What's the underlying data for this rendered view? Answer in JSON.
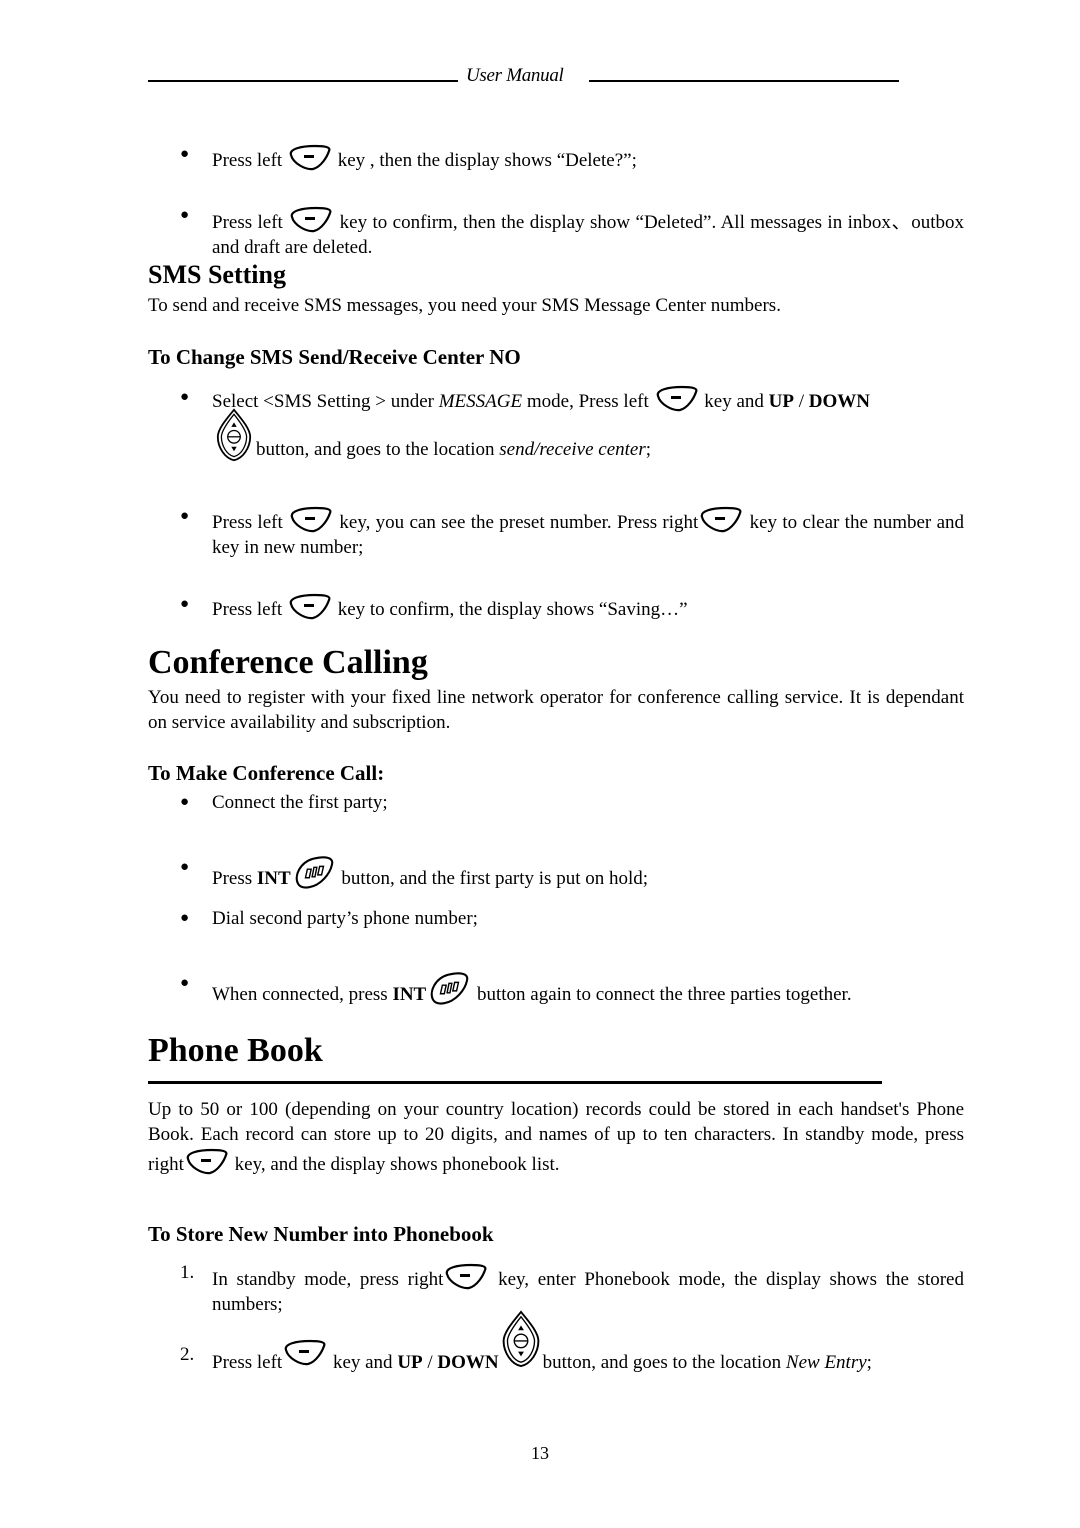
{
  "header": {
    "title": "User Manual"
  },
  "delete_steps": [
    {
      "pre": "Press left",
      "icon": "soft-key-icon",
      "post": " key , then the display shows “Delete?”;"
    },
    {
      "pre": "Press left",
      "icon": "soft-key-icon",
      "post": "key to confirm, then the display show “Deleted”. All messages  in inbox、outbox and draft are deleted."
    }
  ],
  "sms_setting": {
    "title": "SMS Setting",
    "intro": "To send and receive SMS messages, you need your SMS Message Center numbers.",
    "subsection_title": "To Change SMS Send/Receive Center NO",
    "steps": [
      {
        "a": "Select <SMS Setting > under ",
        "a_italic": "MESSAGE",
        "b": " mode, Press left",
        "c": " key and ",
        "bold1": "UP",
        "slash": " / ",
        "bold2": "DOWN",
        "d": "button, and goes to the location ",
        "d_italic": "send/receive center",
        "e": ";"
      },
      {
        "a": "Press left",
        "b": " key, you can see the preset number. Press right",
        "c": " key to clear the number and key in new number;"
      },
      {
        "a": "Press left",
        "b": " key to confirm, the display shows “Saving…”"
      }
    ]
  },
  "conference_calling": {
    "title": "Conference Calling",
    "intro": "You need to register with your fixed line network operator for conference calling service. It is dependant on service availability and subscription.",
    "subsection_title": "To Make Conference Call:",
    "steps": [
      {
        "text": "Connect the first party;"
      },
      {
        "a": "Press ",
        "bold": "INT",
        "b": " button, and the first party is put on hold;"
      },
      {
        "text": "Dial second party’s phone number;"
      },
      {
        "a": "When connected, press ",
        "bold": "INT",
        "b": " button again to connect the three parties together."
      }
    ]
  },
  "phone_book": {
    "title": "Phone Book",
    "intro_a": "Up to 50 or 100 (depending on your country location) records could be stored in each handset's Phone Book. Each record can store up to 20 digits, and names of up to ten characters. In standby mode, press right",
    "intro_b": " key, and the display shows phonebook list.",
    "subsection_title": "To Store New Number into Phonebook",
    "steps": [
      {
        "num": "1.",
        "a": "In standby mode, press right",
        "b": " key, enter Phonebook mode, the display shows the stored numbers;"
      },
      {
        "num": "2.",
        "a": "Press left",
        "b": " key and ",
        "bold1": "UP",
        "slash": " / ",
        "bold2": "DOWN",
        "c": "button, and goes to the location ",
        "c_italic": "New Entry",
        "d": ";"
      }
    ]
  },
  "footer": {
    "page_number": "13"
  }
}
